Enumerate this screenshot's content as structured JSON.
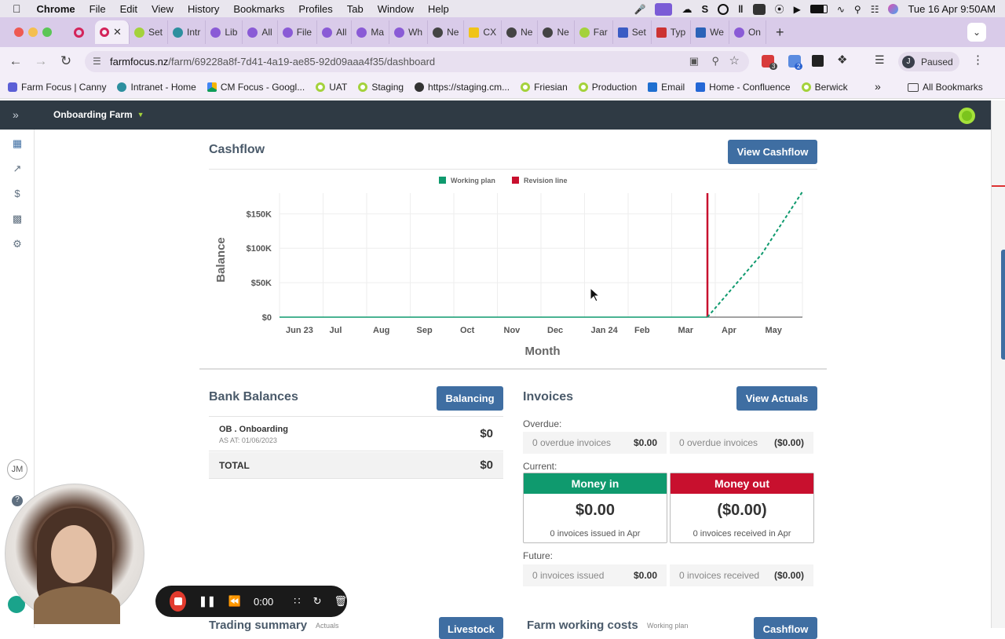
{
  "menubar": {
    "app": "Chrome",
    "items": [
      "File",
      "Edit",
      "View",
      "History",
      "Bookmarks",
      "Profiles",
      "Tab",
      "Window",
      "Help"
    ],
    "clock": "Tue 16 Apr  9:50AM"
  },
  "tabs": [
    {
      "label": "Set"
    },
    {
      "label": "Intr"
    },
    {
      "label": "Lib"
    },
    {
      "label": "All"
    },
    {
      "label": "File"
    },
    {
      "label": "All"
    },
    {
      "label": "Ma"
    },
    {
      "label": "Wh"
    },
    {
      "label": "Ne"
    },
    {
      "label": "CX"
    },
    {
      "label": "Ne"
    },
    {
      "label": "Ne"
    },
    {
      "label": "Far"
    },
    {
      "label": "Set"
    },
    {
      "label": "Typ"
    },
    {
      "label": "We"
    },
    {
      "label": "On"
    }
  ],
  "toolbar": {
    "url_host": "farmfocus.nz",
    "url_path": "/farm/69228a8f-7d41-4a19-ae85-92d09aaa4f35/dashboard",
    "profile_initial": "J",
    "profile_status": "Paused",
    "ext_badge1": "3",
    "ext_badge2": "2"
  },
  "bookmarks": [
    "Farm Focus | Canny",
    "Intranet - Home",
    "CM Focus - Googl...",
    "UAT",
    "Staging",
    "https://staging.cm...",
    "Friesian",
    "Production",
    "Email",
    "Home - Confluence",
    "Berwick"
  ],
  "bookmarks_all": "All Bookmarks",
  "app_header": {
    "farm_name": "Onboarding Farm"
  },
  "sidebar": {
    "user_initials": "JM"
  },
  "cashflow": {
    "title": "Cashflow",
    "button": "View Cashflow"
  },
  "chart_data": {
    "type": "line",
    "xlabel": "Month",
    "ylabel": "Balance",
    "categories": [
      "Jun 23",
      "Jul",
      "Aug",
      "Sep",
      "Oct",
      "Nov",
      "Dec",
      "Jan 24",
      "Feb",
      "Mar",
      "Apr",
      "May"
    ],
    "ytick_labels": [
      "$0",
      "$50K",
      "$100K",
      "$150K"
    ],
    "ylim": [
      0,
      180000
    ],
    "legend": "top-center",
    "grid": true,
    "series": [
      {
        "name": "Working plan",
        "color": "#0f9a6e",
        "style": "dashed",
        "x": [
          "Apr",
          "May",
          "end of May"
        ],
        "values": [
          0,
          92000,
          182000
        ]
      },
      {
        "name": "Revision line",
        "color": "#c8102e",
        "style": "vertical",
        "x": "Apr"
      }
    ]
  },
  "bank": {
    "title": "Bank Balances",
    "button": "Balancing",
    "account_name": "OB . Onboarding",
    "account_asat": "AS AT: 01/06/2023",
    "account_value": "$0",
    "total_label": "TOTAL",
    "total_value": "$0"
  },
  "invoices": {
    "title": "Invoices",
    "button": "View Actuals",
    "overdue_label": "Overdue:",
    "overdue_in_text": "0 overdue invoices",
    "overdue_in_amt": "$0.00",
    "overdue_out_text": "0 overdue invoices",
    "overdue_out_amt": "($0.00)",
    "current_label": "Current:",
    "money_in": {
      "label": "Money in",
      "amount": "$0.00",
      "sub": "0 invoices issued in Apr",
      "color": "#0f9a6e"
    },
    "money_out": {
      "label": "Money out",
      "amount": "($0.00)",
      "sub": "0 invoices received in Apr",
      "color": "#c8102e"
    },
    "future_label": "Future:",
    "future_in_text": "0 invoices issued",
    "future_in_amt": "$0.00",
    "future_out_text": "0 invoices received",
    "future_out_amt": "($0.00)"
  },
  "bottom": {
    "trading_title": "Trading summary",
    "trading_sub": "Actuals",
    "trading_button": "Livestock",
    "costs_title": "Farm working costs",
    "costs_sub": "Working plan",
    "costs_button": "Cashflow"
  },
  "recorder": {
    "time": "0:00"
  }
}
